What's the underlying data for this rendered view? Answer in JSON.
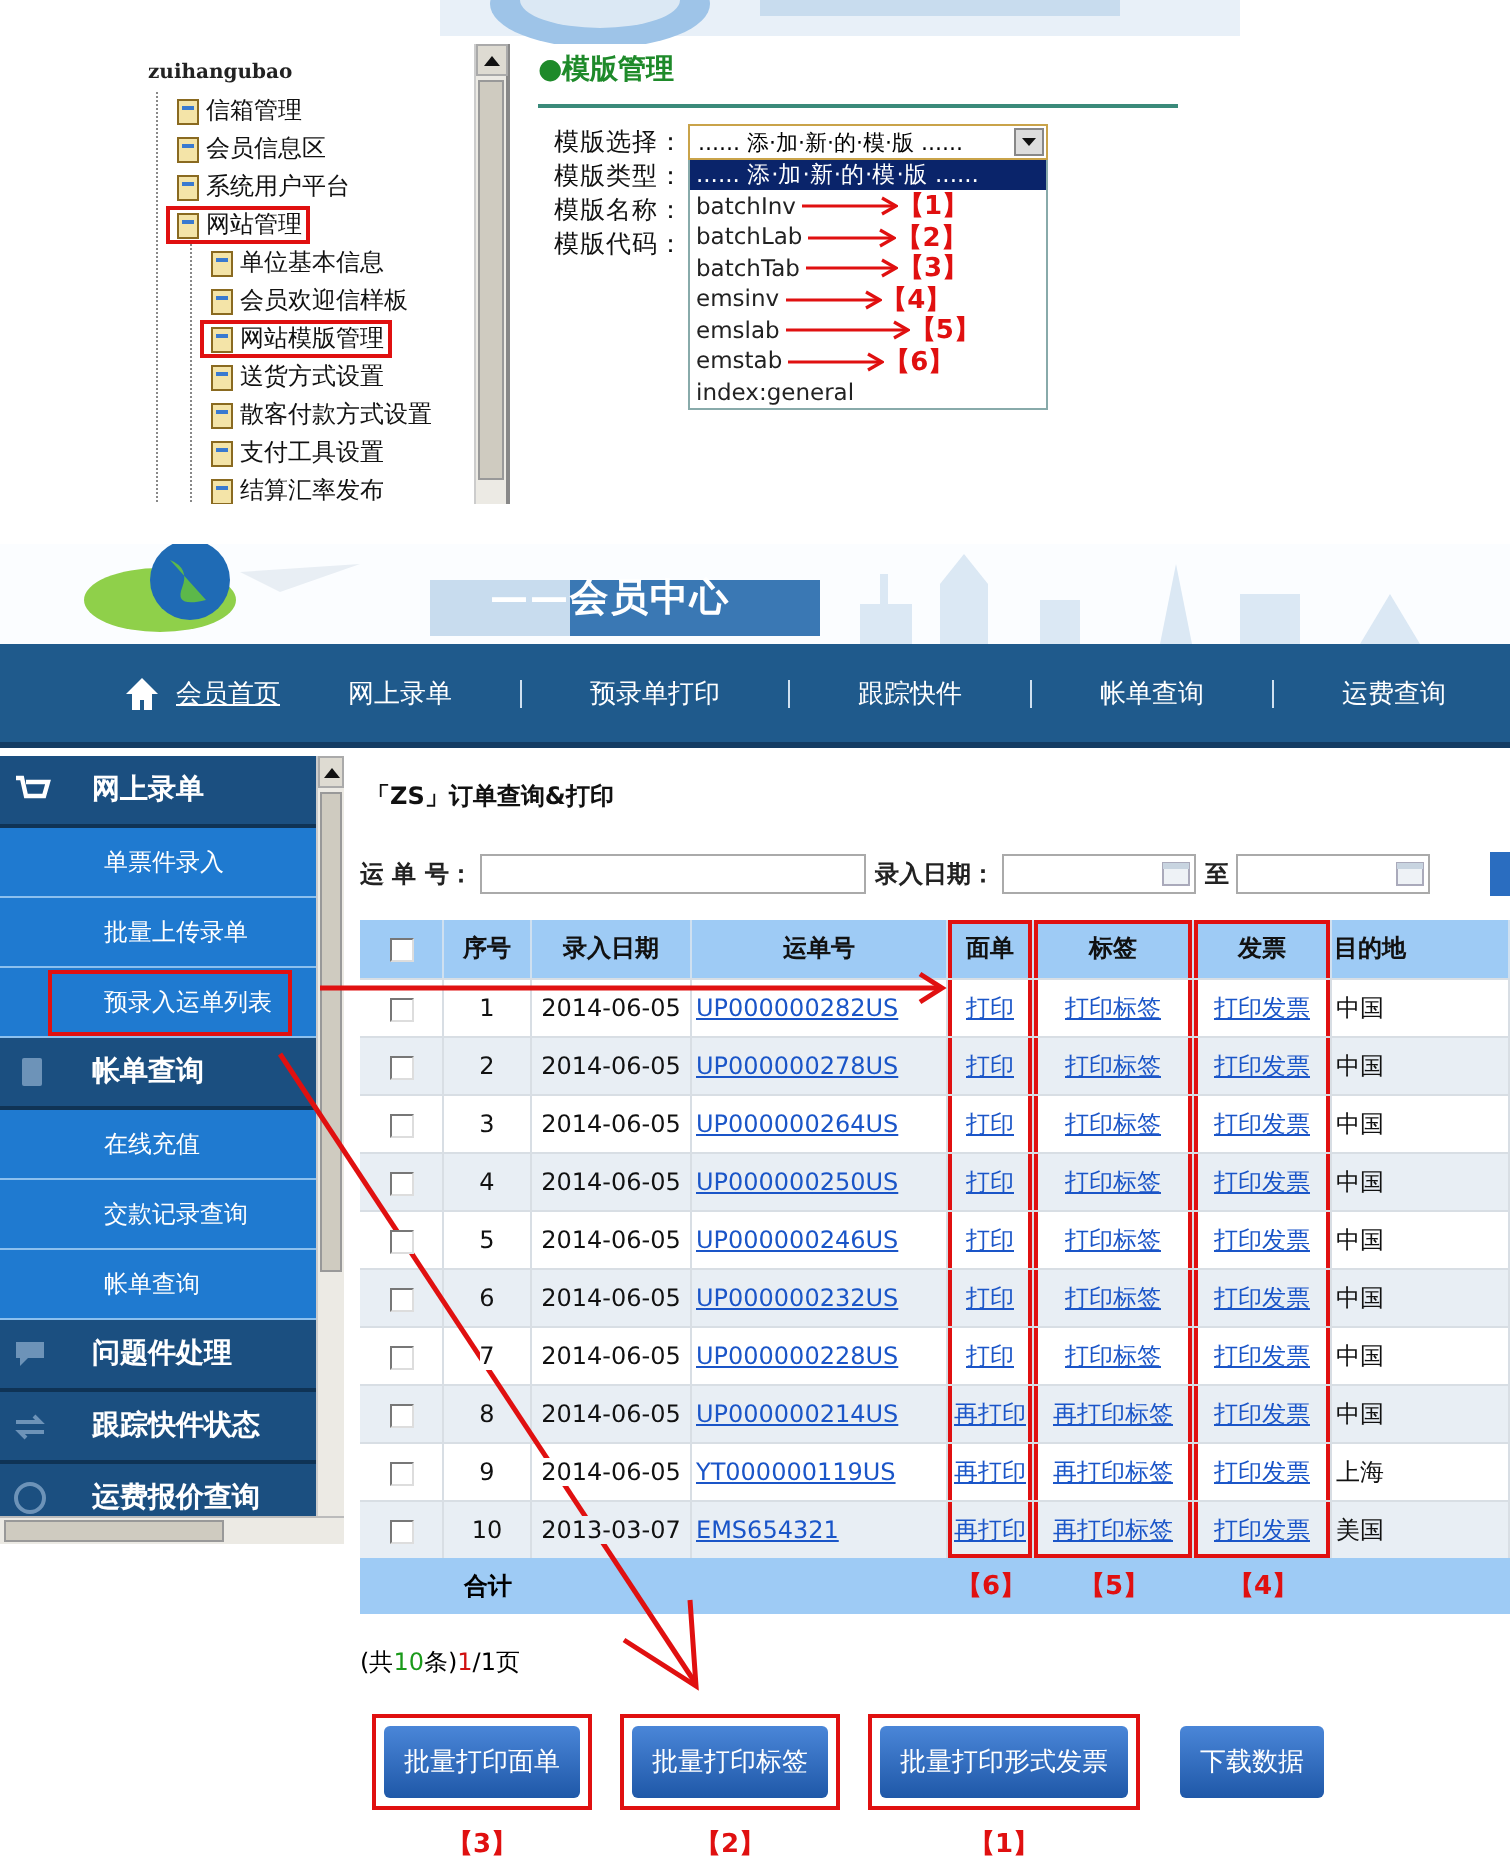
{
  "tree": {
    "root": "zuihangubao",
    "children": [
      {
        "label": "信箱管理",
        "marked": false
      },
      {
        "label": "会员信息区",
        "marked": false
      },
      {
        "label": "系统用户平台",
        "marked": false
      },
      {
        "label": "网站管理",
        "marked": true,
        "children": [
          {
            "label": "单位基本信息",
            "marked": false
          },
          {
            "label": "会员欢迎信样板",
            "marked": false
          },
          {
            "label": "网站模版管理",
            "marked": true
          },
          {
            "label": "送货方式设置",
            "marked": false
          },
          {
            "label": "散客付款方式设置",
            "marked": false
          },
          {
            "label": "支付工具设置",
            "marked": false
          },
          {
            "label": "结算汇率发布",
            "marked": false
          }
        ]
      }
    ]
  },
  "template_panel": {
    "title": "●模版管理",
    "fields": [
      {
        "label": "模版选择："
      },
      {
        "label": "模版类型："
      },
      {
        "label": "模版名称："
      },
      {
        "label": "模版代码："
      }
    ],
    "select": {
      "value": "...... 添·加·新·的·模·版 ......"
    },
    "options": [
      {
        "label": "...... 添·加·新·的·模·版 ......",
        "selected": true
      },
      {
        "label": "batchInv",
        "selected": false,
        "tag": "【1】"
      },
      {
        "label": "batchLab",
        "selected": false,
        "tag": "【2】"
      },
      {
        "label": "batchTab",
        "selected": false,
        "tag": "【3】"
      },
      {
        "label": "emsinv",
        "selected": false,
        "tag": "【4】"
      },
      {
        "label": "emslab",
        "selected": false,
        "tag": "【5】"
      },
      {
        "label": "emstab",
        "selected": false,
        "tag": "【6】"
      },
      {
        "label": "index:general",
        "selected": false
      }
    ]
  },
  "portal": {
    "banner_subtitle": "——会员中心",
    "nav": [
      {
        "label": "会员首页",
        "selected": true
      },
      {
        "label": "网上录单",
        "selected": false
      },
      {
        "label": "预录单打印",
        "selected": false
      },
      {
        "label": "跟踪快件",
        "selected": false
      },
      {
        "label": "帐单查询",
        "selected": false
      },
      {
        "label": "运费查询",
        "selected": false
      }
    ],
    "sidebar": [
      {
        "kind": "group",
        "label": "网上录单"
      },
      {
        "kind": "item",
        "label": "单票件录入",
        "marked": false
      },
      {
        "kind": "item",
        "label": "批量上传录单",
        "marked": false
      },
      {
        "kind": "item",
        "label": "预录入运单列表",
        "marked": true
      },
      {
        "kind": "group",
        "label": "帐单查询"
      },
      {
        "kind": "item",
        "label": "在线充值",
        "marked": false
      },
      {
        "kind": "item",
        "label": "交款记录查询",
        "marked": false
      },
      {
        "kind": "item",
        "label": "帐单查询",
        "marked": false
      },
      {
        "kind": "group",
        "label": "问题件处理"
      },
      {
        "kind": "group",
        "label": "跟踪快件状态"
      },
      {
        "kind": "group",
        "label": "运费报价查询"
      }
    ],
    "page_title": "「ZS」订单查询&打印",
    "search": [
      {
        "label": "运 单 号：",
        "kind": "text"
      },
      {
        "label": "录入日期：",
        "kind": "date"
      },
      {
        "label": "至",
        "kind": "date"
      }
    ],
    "table": {
      "select_all": {
        "checked": false
      },
      "columns": [
        {
          "kind": "text",
          "label": "序号"
        },
        {
          "kind": "text",
          "label": "录入日期"
        },
        {
          "kind": "link",
          "label": "运单号"
        },
        {
          "kind": "link",
          "label": "面单",
          "marked": true,
          "tag": "【6】"
        },
        {
          "kind": "link",
          "label": "标签",
          "marked": true,
          "tag": "【5】"
        },
        {
          "kind": "link",
          "label": "发票",
          "marked": true,
          "tag": "【4】"
        },
        {
          "kind": "text",
          "label": "目的地"
        }
      ],
      "rows": [
        {
          "checked": false,
          "cells": [
            "1",
            "2014-06-05",
            "UP000000282US",
            "打印",
            "打印标签",
            "打印发票",
            "中国"
          ]
        },
        {
          "checked": false,
          "cells": [
            "2",
            "2014-06-05",
            "UP000000278US",
            "打印",
            "打印标签",
            "打印发票",
            "中国"
          ]
        },
        {
          "checked": false,
          "cells": [
            "3",
            "2014-06-05",
            "UP000000264US",
            "打印",
            "打印标签",
            "打印发票",
            "中国"
          ]
        },
        {
          "checked": false,
          "cells": [
            "4",
            "2014-06-05",
            "UP000000250US",
            "打印",
            "打印标签",
            "打印发票",
            "中国"
          ]
        },
        {
          "checked": false,
          "cells": [
            "5",
            "2014-06-05",
            "UP000000246US",
            "打印",
            "打印标签",
            "打印发票",
            "中国"
          ]
        },
        {
          "checked": false,
          "cells": [
            "6",
            "2014-06-05",
            "UP000000232US",
            "打印",
            "打印标签",
            "打印发票",
            "中国"
          ]
        },
        {
          "checked": false,
          "cells": [
            "7",
            "2014-06-05",
            "UP000000228US",
            "打印",
            "打印标签",
            "打印发票",
            "中国"
          ]
        },
        {
          "checked": false,
          "cells": [
            "8",
            "2014-06-05",
            "UP000000214US",
            "再打印",
            "再打印标签",
            "打印发票",
            "中国"
          ]
        },
        {
          "checked": false,
          "cells": [
            "9",
            "2014-06-05",
            "YT000000119US",
            "再打印",
            "再打印标签",
            "打印发票",
            "上海"
          ]
        },
        {
          "checked": false,
          "cells": [
            "10",
            "2013-03-07",
            "EMS654321",
            "再打印",
            "再打印标签",
            "打印发票",
            "美国"
          ]
        }
      ],
      "total": "合计"
    },
    "pager": {
      "prefix": "(共",
      "count": "10",
      "mid": "条)",
      "page": "1",
      "suffix": "/1页"
    },
    "buttons": [
      {
        "label": "批量打印面单",
        "marked": true,
        "tag": "【3】"
      },
      {
        "label": "批量打印标签",
        "marked": true,
        "tag": "【2】"
      },
      {
        "label": "批量打印形式发票",
        "marked": true,
        "tag": "【1】"
      },
      {
        "label": "下载数据",
        "marked": false
      }
    ]
  }
}
